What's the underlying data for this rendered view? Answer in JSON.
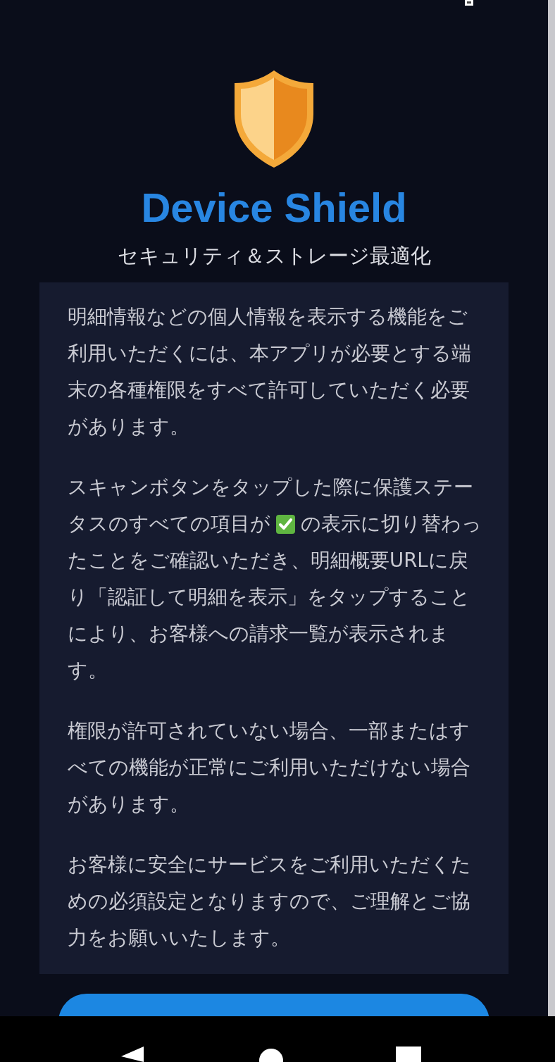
{
  "app": {
    "title": "Device Shield",
    "subtitle": "セキュリティ＆ストレージ最適化"
  },
  "notice": {
    "paragraphs": [
      {
        "kind": "text",
        "text": "明細情報などの個人情報を表示する機能をご利用いただくには、本アプリが必要とする端末の各種権限をすべて許可していただく必要があります。"
      },
      {
        "kind": "check",
        "before": "スキャンボタンをタップした際に保護ステータスのすべての項目が",
        "after": "の表示に切り替わったことをご確認いただき、明細概要URLに戻り「認証して明細を表示」をタップすることにより、お客様への請求一覧が表示されます。"
      },
      {
        "kind": "text",
        "text": "権限が許可されていない場合、一部またはすべての機能が正常にご利用いただけない場合があります。"
      },
      {
        "kind": "text",
        "text": "お客様に安全にサービスをご利用いただくための必須設定となりますので、ご理解とご協力をお願いいたします。"
      }
    ]
  }
}
